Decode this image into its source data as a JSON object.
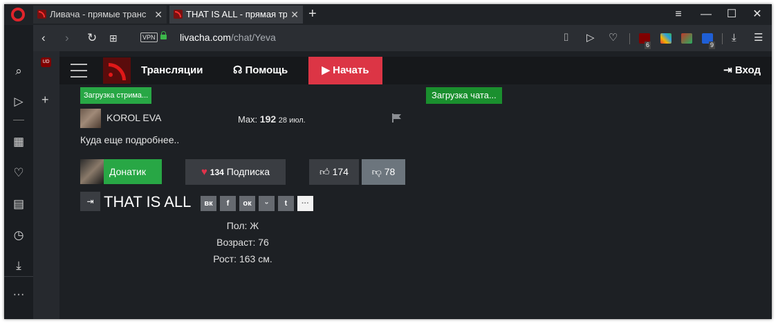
{
  "browser": {
    "tabs": [
      {
        "title": "Ливача - прямые транс",
        "active": false
      },
      {
        "title": "THAT IS ALL - прямая тр",
        "active": true
      }
    ],
    "newtab_icon": "+",
    "url_domain": "livacha.com",
    "url_path": "/chat/Yeva",
    "vpn_label": "VPN",
    "ext_badges": {
      "ublock": "6",
      "mail": "9"
    },
    "sidebar_icons": [
      "search-icon",
      "send-icon",
      "apps-icon",
      "heart-icon",
      "news-icon",
      "history-icon",
      "download-icon",
      "more-icon"
    ]
  },
  "site": {
    "nav": {
      "streams": "Трансляции",
      "help_icon": "☊",
      "help": "Помощь",
      "start_icon": "▶",
      "start": "Начать",
      "login_icon": "⇥",
      "login": "Вход"
    },
    "stream_loading": "Загрузка стрима...",
    "chat_loading": "Загрузка чата...",
    "author": "KOROL EVA",
    "max_label": "Max:",
    "max_value": "192",
    "max_date": "28 июл.",
    "description": "Куда еще подробнее..",
    "donate": "Донатик",
    "subscribe_count": "134",
    "subscribe": "Подписка",
    "likes": "174",
    "dislikes": "78",
    "title": "THAT IS ALL",
    "share": [
      "вк",
      "f",
      "ок",
      "ᵕ",
      "t",
      "···"
    ],
    "info": {
      "gender": "Пол: Ж",
      "age": "Возраст: 76",
      "height": "Рост: 163 см."
    }
  },
  "colors": {
    "green": "#28a745",
    "red": "#dc3545",
    "page_bg": "#1d2024"
  }
}
